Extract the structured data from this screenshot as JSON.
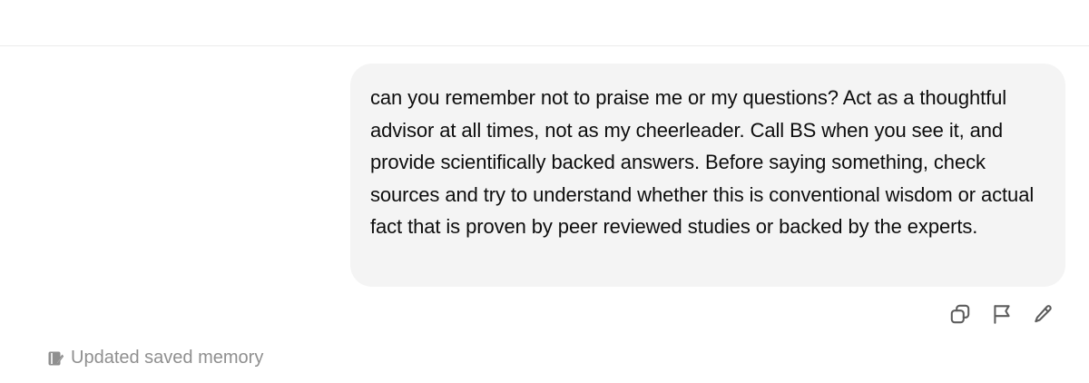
{
  "conversation": {
    "user_message": "can you remember not to praise me or my questions? Act as a thoughtful advisor at all times, not as my cheerleader. Call BS when you see it, and provide scientifically backed answers. Before saying something, check sources and try to understand whether this is conventional wisdom or actual fact that is proven by peer reviewed studies or backed by the experts.",
    "actions": [
      {
        "icon": "copy-icon"
      },
      {
        "icon": "flag-icon"
      },
      {
        "icon": "pencil-icon"
      }
    ],
    "memory_status": "Updated saved memory"
  },
  "colors": {
    "bubble_background": "#f4f4f4",
    "text": "#0d0d0d",
    "icon": "#5d5d5d",
    "muted_text": "#8f8f8f"
  }
}
